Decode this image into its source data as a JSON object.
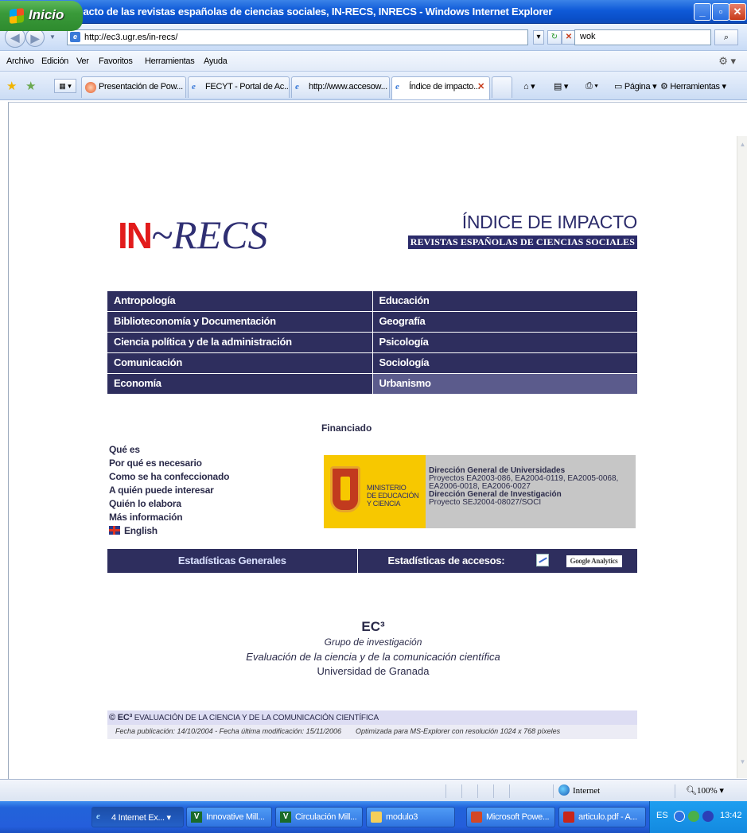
{
  "window": {
    "title": "Índice de impacto de las revistas españolas de ciencias sociales, IN-RECS, INRECS - Windows Internet Explorer"
  },
  "address": {
    "url": "http://ec3.ugr.es/in-recs/",
    "search_value": "wok"
  },
  "menu": [
    "Archivo",
    "Edición",
    "Ver",
    "Favoritos",
    "Herramientas",
    "Ayuda"
  ],
  "tabs": [
    {
      "label": "Presentación de Pow..."
    },
    {
      "label": "FECYT - Portal de Ac..."
    },
    {
      "label": "http://www.accesow..."
    },
    {
      "label": "Índice de impacto..."
    }
  ],
  "toolbar": {
    "page_label": "Página",
    "tools_label": "Herramientas"
  },
  "page": {
    "logo_in": "IN",
    "logo_recs": "~RECS",
    "title": "ÍNDICE DE IMPACTO",
    "subtitle": "REVISTAS ESPAÑOLAS DE CIENCIAS SOCIALES",
    "disciplines": [
      [
        "Antropología",
        "Educación"
      ],
      [
        "Biblioteconomía y Documentación",
        "Geografía"
      ],
      [
        "Ciencia política y de la administración",
        "Psicología"
      ],
      [
        "Comunicación",
        "Sociología"
      ],
      [
        "Economía",
        "Urbanismo"
      ]
    ],
    "funded_label": "Financiado",
    "info_links": [
      "Qué es",
      "Por qué es necesario",
      "Como se ha confeccionado",
      "A quién puede interesar",
      "Quién lo elabora",
      "Más información"
    ],
    "english_link": "English",
    "ministry": [
      "MINISTERIO",
      "DE EDUCACIÓN",
      "Y CIENCIA"
    ],
    "grants": {
      "org1": "Dirección General de Universidades",
      "proj1": "Proyectos EA2003-086, EA2004-0119, EA2005-0068, EA2006-0018, EA2006-0027",
      "org2": "Dirección General de Investigación",
      "proj2": "Proyecto SEJ2004-08027/SOCI"
    },
    "stats_general": "Estadísticas Generales",
    "stats_access": "Estadísticas de accesos:",
    "google_badge": "Google Analytics",
    "group": {
      "name": "EC³",
      "line1": "Grupo de investigación",
      "line2": "Evaluación de la ciencia y de la comunicación científica",
      "line3": "Universidad de Granada"
    },
    "footer": {
      "copyright_mark": "© EC³",
      "copyright_text": "EVALUACIÓN DE LA CIENCIA Y DE LA COMUNICACIÓN CIENTÍFICA",
      "dates": "Fecha publicación: 14/10/2004 - Fecha última modificación: 15/11/2006",
      "optimized": "Optimizada para MS-Explorer con resolución 1024 x 768 píxeles"
    }
  },
  "status": {
    "zone": "Internet",
    "zoom": "100%"
  },
  "taskbar": {
    "start": "Inicio",
    "items": [
      "4 Internet Ex...",
      "Innovative Mill...",
      "Circulación Mill...",
      "modulo3",
      "Microsoft Powe...",
      "articulo.pdf - A..."
    ],
    "lang": "ES",
    "clock": "13:42"
  }
}
